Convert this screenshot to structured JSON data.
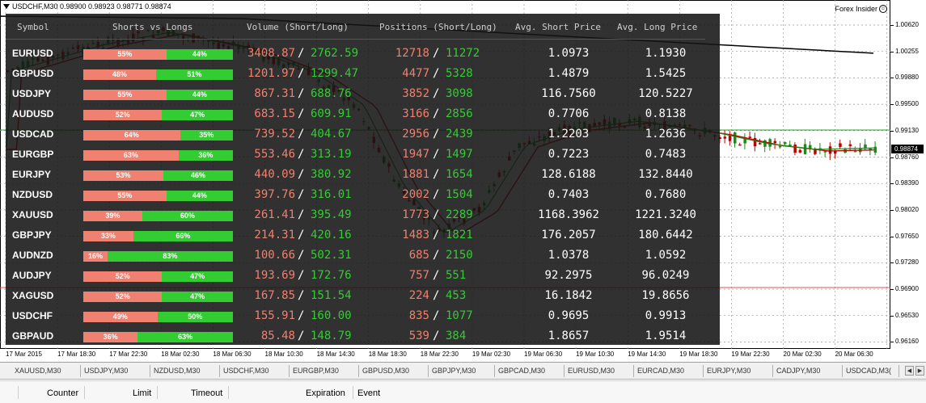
{
  "window": {
    "title": "USDCHF,M30  0.98900 0.98923 0.98771 0.98874",
    "badge": "Forex Insider",
    "current_price": "0.98874"
  },
  "price_scale": [
    "1.00620",
    "1.00255",
    "0.99880",
    "0.99500",
    "0.99130",
    "0.98760",
    "0.98390",
    "0.98020",
    "0.97650",
    "0.97280",
    "0.96900",
    "0.96530",
    "0.96160"
  ],
  "time_scale": [
    "17 Mar 2015",
    "17 Mar 18:30",
    "17 Mar 22:30",
    "18 Mar 02:30",
    "18 Mar 06:30",
    "18 Mar 10:30",
    "18 Mar 14:30",
    "18 Mar 18:30",
    "18 Mar 22:30",
    "19 Mar 02:30",
    "19 Mar 06:30",
    "19 Mar 10:30",
    "19 Mar 14:30",
    "19 Mar 18:30",
    "19 Mar 22:30",
    "20 Mar 02:30",
    "20 Mar 06:30"
  ],
  "panel": {
    "headers": {
      "symbol": "Symbol",
      "shorts_vs_longs": "Shorts vs Longs",
      "volume": "Volume (Short/Long)",
      "positions": "Positions (Short/Long)",
      "avg_short": "Avg. Short Price",
      "avg_long": "Avg. Long Price"
    },
    "separator": "/",
    "rows": [
      {
        "symbol": "EURUSD",
        "short_pct": "55%",
        "long_pct": "44%",
        "vol_short": "3408.87",
        "vol_long": "2762.59",
        "pos_short": "12718",
        "pos_long": "11272",
        "avg_short": "1.0973",
        "avg_long": "1.1930"
      },
      {
        "symbol": "GBPUSD",
        "short_pct": "48%",
        "long_pct": "51%",
        "vol_short": "1201.97",
        "vol_long": "1299.47",
        "pos_short": "4477",
        "pos_long": "5328",
        "avg_short": "1.4879",
        "avg_long": "1.5425"
      },
      {
        "symbol": "USDJPY",
        "short_pct": "55%",
        "long_pct": "44%",
        "vol_short": "867.31",
        "vol_long": "688.76",
        "pos_short": "3852",
        "pos_long": "3098",
        "avg_short": "116.7560",
        "avg_long": "120.5227"
      },
      {
        "symbol": "AUDUSD",
        "short_pct": "52%",
        "long_pct": "47%",
        "vol_short": "683.15",
        "vol_long": "609.91",
        "pos_short": "3166",
        "pos_long": "2856",
        "avg_short": "0.7706",
        "avg_long": "0.8138"
      },
      {
        "symbol": "USDCAD",
        "short_pct": "64%",
        "long_pct": "35%",
        "vol_short": "739.52",
        "vol_long": "404.67",
        "pos_short": "2956",
        "pos_long": "2439",
        "avg_short": "1.2203",
        "avg_long": "1.2636"
      },
      {
        "symbol": "EURGBP",
        "short_pct": "63%",
        "long_pct": "36%",
        "vol_short": "553.46",
        "vol_long": "313.19",
        "pos_short": "1947",
        "pos_long": "1497",
        "avg_short": "0.7223",
        "avg_long": "0.7483"
      },
      {
        "symbol": "EURJPY",
        "short_pct": "53%",
        "long_pct": "46%",
        "vol_short": "440.09",
        "vol_long": "380.92",
        "pos_short": "1881",
        "pos_long": "1654",
        "avg_short": "128.6188",
        "avg_long": "132.8440"
      },
      {
        "symbol": "NZDUSD",
        "short_pct": "55%",
        "long_pct": "44%",
        "vol_short": "397.76",
        "vol_long": "316.01",
        "pos_short": "2002",
        "pos_long": "1504",
        "avg_short": "0.7403",
        "avg_long": "0.7680"
      },
      {
        "symbol": "XAUUSD",
        "short_pct": "39%",
        "long_pct": "60%",
        "vol_short": "261.41",
        "vol_long": "395.49",
        "pos_short": "1773",
        "pos_long": "2289",
        "avg_short": "1168.3962",
        "avg_long": "1221.3240"
      },
      {
        "symbol": "GBPJPY",
        "short_pct": "33%",
        "long_pct": "66%",
        "vol_short": "214.31",
        "vol_long": "420.16",
        "pos_short": "1483",
        "pos_long": "1821",
        "avg_short": "176.2057",
        "avg_long": "180.6442"
      },
      {
        "symbol": "AUDNZD",
        "short_pct": "16%",
        "long_pct": "83%",
        "vol_short": "100.66",
        "vol_long": "502.31",
        "pos_short": "685",
        "pos_long": "2150",
        "avg_short": "1.0378",
        "avg_long": "1.0592"
      },
      {
        "symbol": "AUDJPY",
        "short_pct": "52%",
        "long_pct": "47%",
        "vol_short": "193.69",
        "vol_long": "172.76",
        "pos_short": "757",
        "pos_long": "551",
        "avg_short": "92.2975",
        "avg_long": "96.0249"
      },
      {
        "symbol": "XAGUSD",
        "short_pct": "52%",
        "long_pct": "47%",
        "vol_short": "167.85",
        "vol_long": "151.54",
        "pos_short": "224",
        "pos_long": "453",
        "avg_short": "16.1842",
        "avg_long": "19.8656"
      },
      {
        "symbol": "USDCHF",
        "short_pct": "49%",
        "long_pct": "50%",
        "vol_short": "155.91",
        "vol_long": "160.00",
        "pos_short": "835",
        "pos_long": "1077",
        "avg_short": "0.9695",
        "avg_long": "0.9913"
      },
      {
        "symbol": "GBPAUD",
        "short_pct": "36%",
        "long_pct": "63%",
        "vol_short": "85.48",
        "vol_long": "148.79",
        "pos_short": "539",
        "pos_long": "384",
        "avg_short": "1.8657",
        "avg_long": "1.9514"
      }
    ]
  },
  "chart_tabs": [
    "XAUUSD,M30",
    "USDJPY,M30",
    "NZDUSD,M30",
    "USDCHF,M30",
    "EURGBP,M30",
    "GBPUSD,M30",
    "GBPJPY,M30",
    "GBPCAD,M30",
    "EURUSD,M30",
    "EURCAD,M30",
    "EURJPY,M30",
    "CADJPY,M30",
    "USDCAD,M3("
  ],
  "terminal_columns": [
    "Counter",
    "Limit",
    "Timeout",
    "Expiration",
    "Event"
  ],
  "colors": {
    "short": "#f08070",
    "long": "#33cc33",
    "panel_bg": "#141414",
    "bull_candle": "#1a8a1a",
    "bear_candle": "#c00000",
    "ma_black": "#000000",
    "ma_red": "#c00000",
    "ma_green": "#1a8a1a"
  }
}
